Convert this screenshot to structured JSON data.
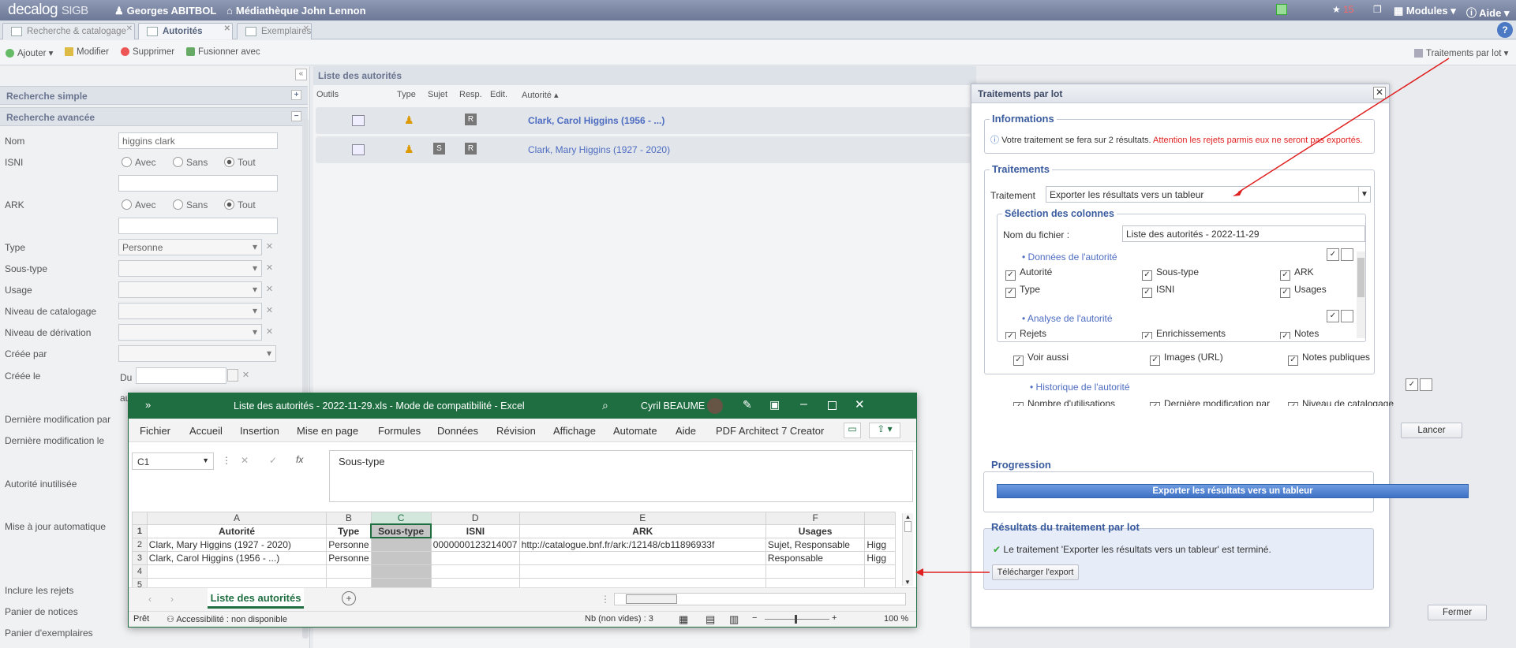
{
  "topbar": {
    "brand": "decalog",
    "brand_suffix": "SIGB",
    "user": "Georges ABITBOL",
    "library": "Médiathèque John Lennon",
    "notif_count": "15",
    "modules": "Modules",
    "help": "Aide"
  },
  "tabs": [
    {
      "label": "Recherche & catalogage"
    },
    {
      "label": "Autorités"
    },
    {
      "label": "Exemplaires"
    }
  ],
  "toolbar": {
    "add": "Ajouter",
    "edit": "Modifier",
    "delete": "Supprimer",
    "merge": "Fusionner avec",
    "batch": "Traitements par lot"
  },
  "left": {
    "simple": "Recherche simple",
    "advanced": "Recherche avancée",
    "fields": {
      "nom": "Nom",
      "nom_value": "higgins clark",
      "isni": "ISNI",
      "ark": "ARK",
      "avec": "Avec",
      "sans": "Sans",
      "tout": "Tout",
      "type": "Type",
      "type_value": "Personne",
      "soustype": "Sous-type",
      "usage": "Usage",
      "niveau": "Niveau de catalogage",
      "derivation": "Niveau de dérivation",
      "creepar": "Créée par",
      "creele": "Créée le",
      "du": "Du",
      "au": "au",
      "dernmodpar": "Dernière modification par",
      "dernmodle": "Dernière modification le",
      "inutilisee": "Autorité inutilisée",
      "majauto": "Mise à jour automatique",
      "rejets": "Inclure les rejets",
      "paniernotices": "Panier de notices",
      "panierex": "Panier d'exemplaires"
    }
  },
  "list": {
    "title": "Liste des autorités",
    "columns": [
      "Outils",
      "Type",
      "Sujet",
      "Resp.",
      "Edit.",
      "Autorité"
    ],
    "rows": [
      {
        "label": "Clark, Carol Higgins (1956 - ...)"
      },
      {
        "label": "Clark, Mary Higgins (1927 - 2020)"
      }
    ]
  },
  "dialog": {
    "title": "Traitements par lot",
    "info_legend": "Informations",
    "info_text": "Votre traitement se fera sur 2 résultats.",
    "info_warning": "Attention les rejets parmis eux ne seront pas exportés.",
    "treat_legend": "Traitements",
    "treat_label": "Traitement",
    "treat_value": "Exporter les résultats vers un tableur",
    "cols_legend": "Sélection des colonnes",
    "filename_label": "Nom du fichier :",
    "filename_value": "Liste des autorités - 2022-11-29",
    "groups": [
      {
        "title": "Données de l'autorité",
        "items": [
          "Autorité",
          "Sous-type",
          "ARK",
          "Type",
          "ISNI",
          "Usages"
        ]
      },
      {
        "title": "Analyse de l'autorité",
        "items": [
          "Rejets",
          "Enrichissements",
          "Notes",
          "Voir aussi",
          "Images (URL)",
          "Notes publiques"
        ]
      },
      {
        "title": "Historique de l'autorité",
        "items": [
          "Nombre d'utilisations",
          "Dernière modification par",
          "Niveau de catalogage"
        ]
      }
    ],
    "launch": "Lancer",
    "progress_legend": "Progression",
    "progress_text": "Exporter les résultats vers un tableur",
    "results_legend": "Résultats du traitement par lot",
    "results_text": "Le traitement 'Exporter les résultats vers un tableur' est terminé.",
    "download": "Télécharger l'export",
    "close": "Fermer"
  },
  "excel": {
    "title": "Liste des autorités - 2022-11-29.xls  -  Mode de compatibilité  -  Excel",
    "user": "Cyril BEAUME",
    "menu": [
      "Fichier",
      "Accueil",
      "Insertion",
      "Mise en page",
      "Formules",
      "Données",
      "Révision",
      "Affichage",
      "Automate",
      "Aide",
      "PDF Architect 7 Creator"
    ],
    "cellref": "C1",
    "fx": "fx",
    "formula": "Sous-type",
    "cols": [
      "A",
      "B",
      "C",
      "D",
      "E",
      "F"
    ],
    "rows": [
      [
        "Autorité",
        "Type",
        "Sous-type",
        "ISNI",
        "ARK",
        "Usages",
        ""
      ],
      [
        "Clark, Mary Higgins (1927 - 2020)",
        "Personne",
        "",
        "0000000123214007",
        "http://catalogue.bnf.fr/ark:/12148/cb11896933f",
        "Sujet, Responsable",
        "Higg"
      ],
      [
        "Clark, Carol Higgins (1956 - ...)",
        "Personne",
        "",
        "",
        "",
        "Responsable",
        "Higg"
      ],
      [
        "",
        "",
        "",
        "",
        "",
        "",
        ""
      ],
      [
        "",
        "",
        "",
        "",
        "",
        "",
        ""
      ]
    ],
    "sheet": "Liste des autorités",
    "status_ready": "Prêt",
    "status_access": "Accessibilité : non disponible",
    "status_count": "Nb (non vides) : 3",
    "zoom": "100 %"
  },
  "colors": {
    "accent": "#1e6e41",
    "arrow": "#e02020",
    "link": "#4e6dc1",
    "progress": "#4a7fd0"
  }
}
